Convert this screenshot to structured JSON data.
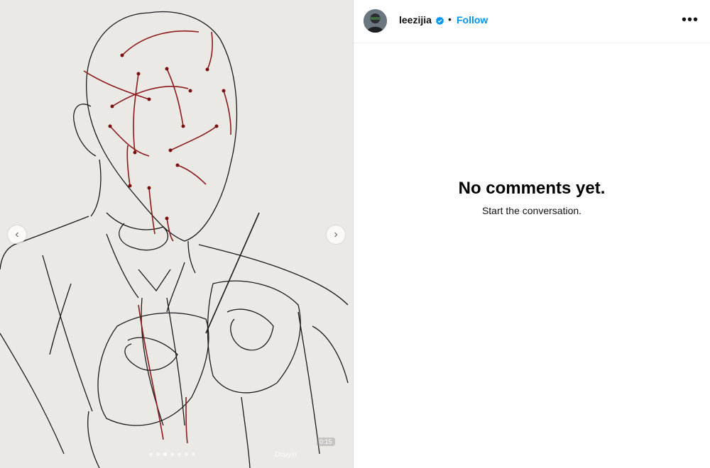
{
  "post": {
    "username": "leezijia",
    "separator": "•",
    "follow_label": "Follow",
    "more_label": "•••"
  },
  "comments": {
    "empty_title": "No comments yet.",
    "empty_subtitle": "Start the conversation."
  },
  "media": {
    "prev_label": "‹",
    "next_label": "›",
    "watermark_badge": "0:15",
    "watermark_text": "Douyin"
  },
  "colors": {
    "link": "#0095f6",
    "verified": "#0095f6",
    "thread": "#8b1a1a"
  }
}
